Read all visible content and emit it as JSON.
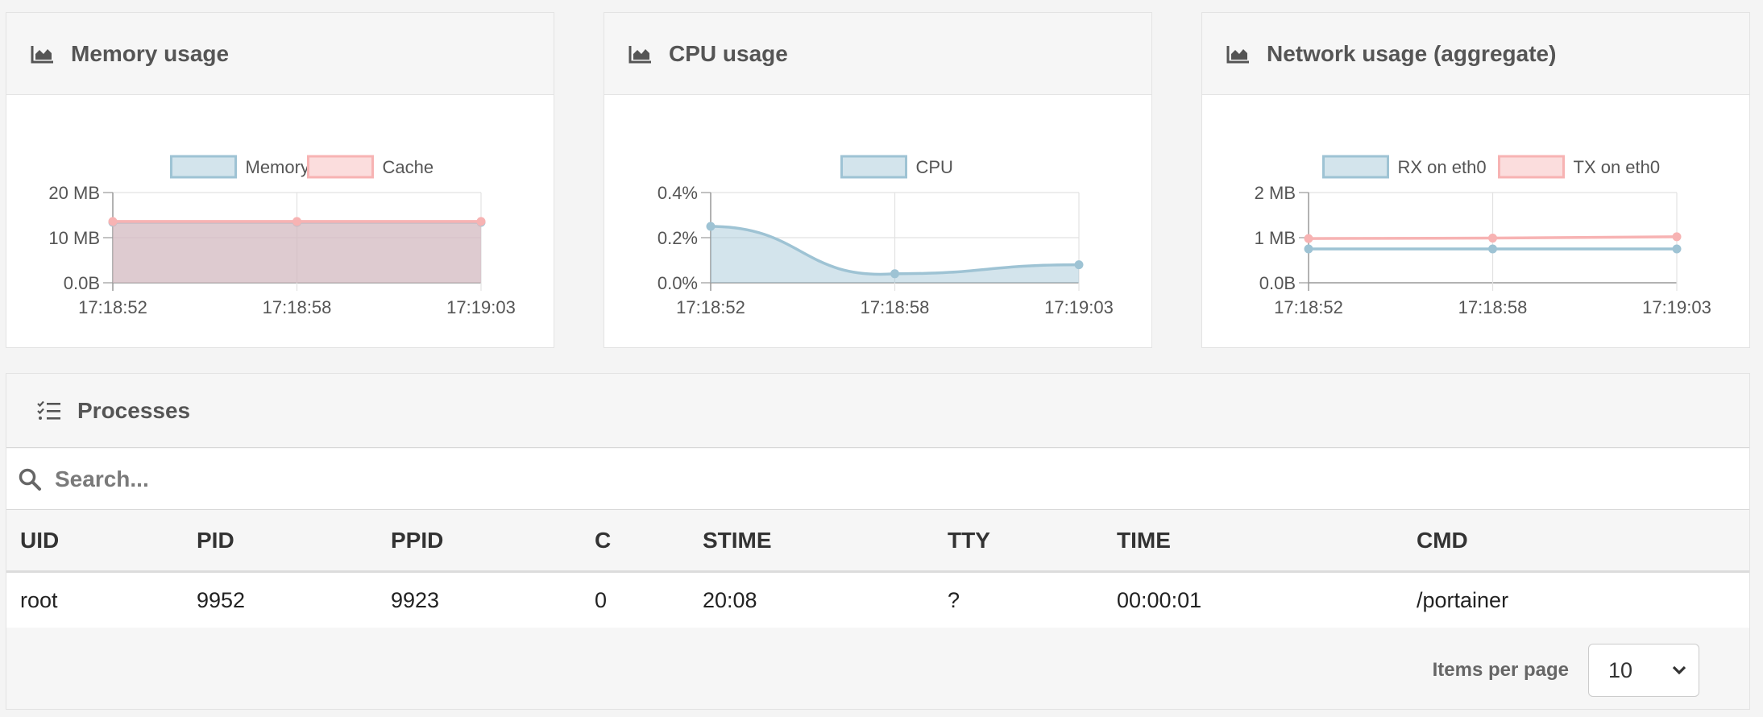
{
  "panels": {
    "memory": {
      "title": "Memory usage"
    },
    "cpu": {
      "title": "CPU usage"
    },
    "network": {
      "title": "Network usage (aggregate)"
    }
  },
  "chart_data": [
    {
      "type": "area",
      "series": [
        {
          "name": "Memory",
          "values": [
            13.4,
            13.4,
            13.4
          ],
          "color": "#9ec3d4"
        },
        {
          "name": "Cache",
          "values": [
            13.6,
            13.6,
            13.6
          ],
          "color": "#f7b3b3"
        }
      ],
      "x": [
        "17:18:52",
        "17:18:58",
        "17:19:03"
      ],
      "y_ticks": [
        "0.0B",
        "10 MB",
        "20 MB"
      ],
      "ylim": [
        0,
        20
      ],
      "grid": true,
      "legend": "top"
    },
    {
      "type": "area",
      "series": [
        {
          "name": "CPU",
          "values": [
            0.25,
            0.04,
            0.08
          ],
          "color": "#9ec3d4"
        }
      ],
      "x": [
        "17:18:52",
        "17:18:58",
        "17:19:03"
      ],
      "y_ticks": [
        "0.0%",
        "0.2%",
        "0.4%"
      ],
      "ylim": [
        0,
        0.4
      ],
      "grid": true,
      "legend": "top"
    },
    {
      "type": "line",
      "series": [
        {
          "name": "RX on eth0",
          "values": [
            0.75,
            0.75,
            0.75
          ],
          "color": "#9ec3d4"
        },
        {
          "name": "TX on eth0",
          "values": [
            0.98,
            0.99,
            1.02
          ],
          "color": "#f7b3b3"
        }
      ],
      "x": [
        "17:18:52",
        "17:18:58",
        "17:19:03"
      ],
      "y_ticks": [
        "0.0B",
        "1 MB",
        "2 MB"
      ],
      "ylim": [
        0,
        2
      ],
      "grid": true,
      "legend": "top"
    }
  ],
  "processes": {
    "title": "Processes",
    "search_placeholder": "Search...",
    "columns": [
      "UID",
      "PID",
      "PPID",
      "C",
      "STIME",
      "TTY",
      "TIME",
      "CMD"
    ],
    "rows": [
      [
        "root",
        "9952",
        "9923",
        "0",
        "20:08",
        "?",
        "00:00:01",
        "/portainer"
      ]
    ],
    "items_per_page_label": "Items per page",
    "items_per_page_value": "10"
  }
}
